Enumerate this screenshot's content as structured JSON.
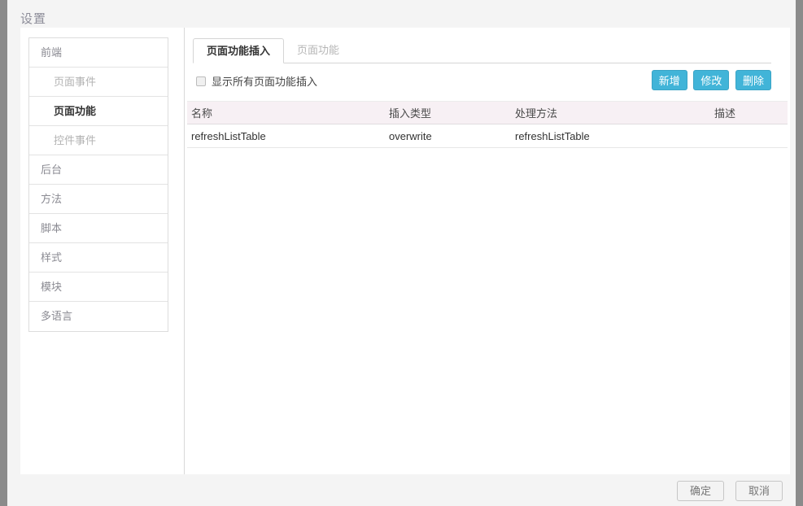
{
  "dialog": {
    "title": "设置"
  },
  "sidebar": {
    "items": [
      {
        "label": "前端",
        "level": "top",
        "state": "normal"
      },
      {
        "label": "页面事件",
        "level": "child",
        "state": "normal"
      },
      {
        "label": "页面功能",
        "level": "child",
        "state": "active"
      },
      {
        "label": "控件事件",
        "level": "child",
        "state": "normal"
      },
      {
        "label": "后台",
        "level": "top",
        "state": "normal"
      },
      {
        "label": "方法",
        "level": "top",
        "state": "normal"
      },
      {
        "label": "脚本",
        "level": "top",
        "state": "normal"
      },
      {
        "label": "样式",
        "level": "top",
        "state": "normal"
      },
      {
        "label": "模块",
        "level": "top",
        "state": "normal"
      },
      {
        "label": "多语言",
        "level": "top",
        "state": "normal"
      }
    ]
  },
  "content": {
    "tabs": [
      {
        "label": "页面功能插入",
        "active": true
      },
      {
        "label": "页面功能",
        "active": false
      }
    ],
    "filter": {
      "checkbox_label": "显示所有页面功能插入",
      "checked": false
    },
    "toolbar": {
      "add_label": "新增",
      "edit_label": "修改",
      "delete_label": "删除",
      "accent_color": "#41b4d8"
    },
    "table": {
      "columns": [
        "名称",
        "插入类型",
        "处理方法",
        "描述"
      ],
      "rows": [
        {
          "name": "refreshListTable",
          "insert_type": "overwrite",
          "handler": "refreshListTable",
          "description": ""
        }
      ],
      "header_bg": "#f7f0f4"
    }
  },
  "footer": {
    "ok_label": "确定",
    "cancel_label": "取消"
  }
}
